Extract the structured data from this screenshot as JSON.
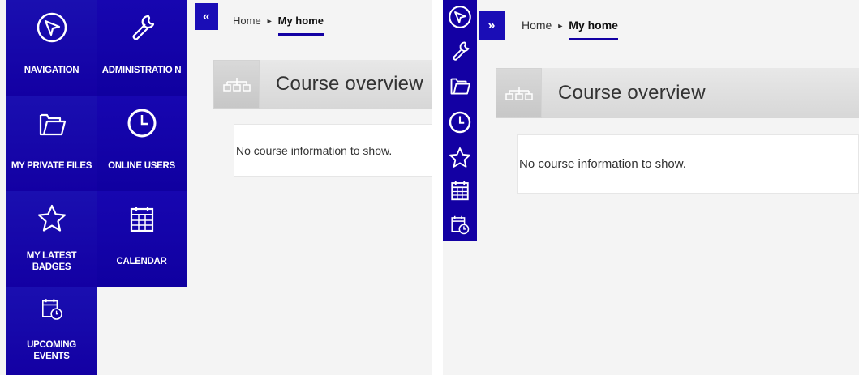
{
  "expanded": {
    "tiles": [
      {
        "label": "NAVIGATION",
        "icon": "navigation-icon"
      },
      {
        "label": "ADMINISTRATIO N",
        "icon": "wrench-icon"
      },
      {
        "label": "MY PRIVATE FILES",
        "icon": "folder-icon"
      },
      {
        "label": "ONLINE USERS",
        "icon": "clock-icon"
      },
      {
        "label": "MY LATEST BADGES",
        "icon": "star-icon"
      },
      {
        "label": "CALENDAR",
        "icon": "calendar-icon"
      },
      {
        "label": "UPCOMING EVENTS",
        "icon": "calendar-clock-icon"
      }
    ],
    "toggle": "«",
    "breadcrumb": {
      "home": "Home",
      "separator": "►",
      "current": "My home"
    },
    "course_title": "Course overview",
    "empty_message": "No course information to show."
  },
  "collapsed": {
    "toggle": "»",
    "breadcrumb": {
      "home": "Home",
      "separator": "►",
      "current": "My home"
    },
    "course_title": "Course overview",
    "empty_message": "No course information to show."
  },
  "colors": {
    "accent": "#1300a3",
    "page_bg": "#f4f4f4",
    "header_bg": "#dcdcdc"
  }
}
